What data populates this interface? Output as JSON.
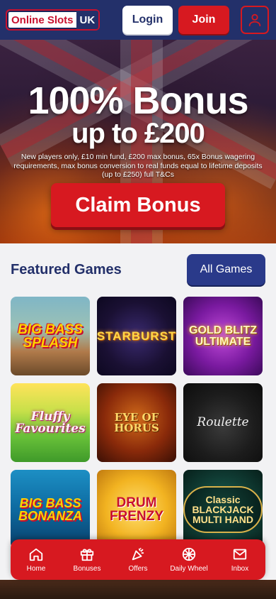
{
  "header": {
    "logo_text": "Online Slots",
    "logo_badge": "UK",
    "login_label": "Login",
    "join_label": "Join",
    "user_icon": "user-icon"
  },
  "hero": {
    "title": "100% Bonus",
    "subtitle": "up to £200",
    "terms": "New players only, £10 min fund, £200 max bonus, 65x Bonus wagering requirements, max bonus conversion to real funds equal to lifetime deposits (up to £250) full T&Cs",
    "cta_label": "Claim Bonus"
  },
  "featured": {
    "title": "Featured Games",
    "all_games_label": "All Games",
    "games": [
      {
        "name": "BIG BASS SPLASH"
      },
      {
        "name": "STARBURST"
      },
      {
        "name": "GOLD BLITZ ULTIMATE"
      },
      {
        "name": "Fluffy Favourites"
      },
      {
        "name": "EYE OF HORUS"
      },
      {
        "name": "Roulette"
      },
      {
        "name": "BIG BASS BONANZA"
      },
      {
        "name": "DRUM FRENZY"
      },
      {
        "name": "Classic BLACKJACK MULTI HAND"
      }
    ]
  },
  "bottom_nav": {
    "items": [
      {
        "label": "Home",
        "icon": "home-icon"
      },
      {
        "label": "Bonuses",
        "icon": "gift-icon"
      },
      {
        "label": "Offers",
        "icon": "party-popper-icon"
      },
      {
        "label": "Daily Wheel",
        "icon": "wheel-icon"
      },
      {
        "label": "Inbox",
        "icon": "mail-icon"
      }
    ]
  },
  "colors": {
    "navy": "#23306a",
    "red": "#d71920",
    "button_blue": "#2a3a8a"
  }
}
